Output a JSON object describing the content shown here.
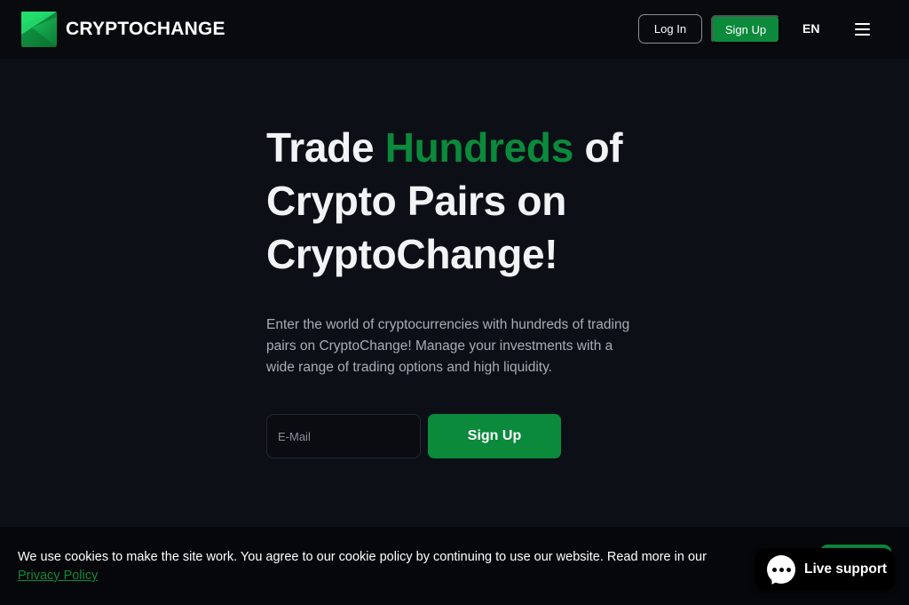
{
  "header": {
    "brand": "CRYPTOCHANGE",
    "login_label": "Log In",
    "signup_label": "Sign Up",
    "language": "EN",
    "menu_icon": "hamburger-menu-icon"
  },
  "hero": {
    "headline_part1": "Trade ",
    "headline_accent": "Hundreds",
    "headline_part2": " of Crypto Pairs on CryptoChange!",
    "lead": "Enter the world of cryptocurrencies with hundreds of trading pairs on CryptoChange! Manage your investments with a wide range of trading options and high liquidity.",
    "email_placeholder": "E-Mail",
    "email_value": "",
    "signup_label": "Sign Up"
  },
  "cookie": {
    "text": "We use cookies to make the site work. You agree to our cookie policy by continuing to use our website. Read more in our ",
    "link": "Privacy Policy"
  },
  "support": {
    "label": "Live support",
    "icon": "chat-bubble-icon"
  },
  "colors": {
    "background": "#0c0f16",
    "header_bg": "#080a0e",
    "accent": "#0b8a3c",
    "text": "#ffffff",
    "muted_text": "#a9adb5"
  }
}
